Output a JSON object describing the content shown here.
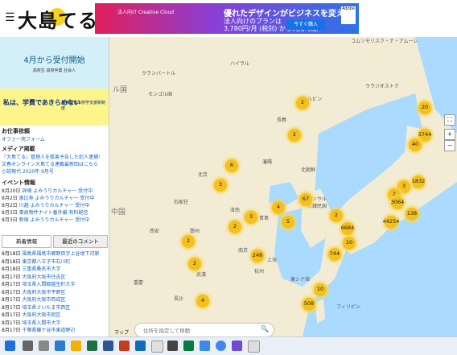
{
  "header": {
    "logo_text": "大島てる"
  },
  "ad_top": {
    "small": "法人向け Creative Cloud",
    "headline": "優れたデザインがビジネスを変える",
    "sub1": "法人向けのプランは",
    "sub2": "3,780円/月 (税別) から利用可能",
    "button": "今すぐ購入",
    "brand": "Adobe"
  },
  "ad_side": {
    "title": "4月から受付開始",
    "sub": "高校生 高校卒業 社会人",
    "slogan": "私は、学費であきらめない",
    "badge": "高等教育の修学支援新制度"
  },
  "sections": {
    "requests": {
      "title": "お仕事依頼",
      "link": "オファー用フォーム"
    },
    "media": {
      "title": "メディア掲載",
      "items": [
        "『大島てる』管理人を殺害予告した犯人逮捕!",
        "文春オンライン大島てる連載最新回はこちら",
        "小説現代 2020年 9月号"
      ]
    },
    "events": {
      "title": "イベント情報",
      "items": [
        {
          "date": "8月20日",
          "text": "詳細 よみうりカルチャー 受付中"
        },
        {
          "date": "8月2日",
          "text": "恵比寿 よみうりカルチャー 受付中"
        },
        {
          "date": "8月2日",
          "text": "川越 よみうりカルチャー 受付中"
        },
        {
          "date": "8月3日",
          "text": "事故物件ナイト番外編 有料配信"
        },
        {
          "date": "8月3日",
          "text": "新宿 よみうりカルチャー 受付中"
        }
      ]
    }
  },
  "tabs": {
    "news": "新着情報",
    "comments": "最近のコメント"
  },
  "news": [
    {
      "date": "8月18日",
      "text": "福島県福島市郷野目字上谷地下河原"
    },
    {
      "date": "8月18日",
      "text": "東京都八王子市石川町"
    },
    {
      "date": "8月18日",
      "text": "三重県桑名市大字"
    },
    {
      "date": "8月17日",
      "text": "大阪府大阪市住吉区"
    },
    {
      "date": "8月17日",
      "text": "埼玉県入間郡越生町大字"
    },
    {
      "date": "8月17日",
      "text": "大阪府大阪市平野区"
    },
    {
      "date": "8月17日",
      "text": "大阪府大阪市西成区"
    },
    {
      "date": "8月17日",
      "text": "埼玉県さいたま市西区"
    },
    {
      "date": "8月17日",
      "text": "大阪府大阪市旭区"
    },
    {
      "date": "8月17日",
      "text": "埼玉県入間市大字"
    },
    {
      "date": "8月17日",
      "text": "千葉県鎌ケ谷市東道野辺"
    }
  ],
  "map": {
    "labels": [
      "ウランバートル",
      "ハイラル",
      "ハルビン",
      "長春",
      "瀋陽",
      "北朝鮮",
      "ソウル",
      "大韓民国",
      "北京",
      "天津",
      "石家荘",
      "済南",
      "青島",
      "鄭州",
      "西安",
      "武漢",
      "南京",
      "上海",
      "杭州",
      "重慶",
      "長沙",
      "東シナ海",
      "フィリピン",
      "モンゴル国",
      "コムソモリスク・ナ・アムーレ",
      "ウラジオストク"
    ],
    "country_labels": [
      "ル国",
      "中国"
    ],
    "clusters": [
      {
        "value": "2"
      },
      {
        "value": "20"
      },
      {
        "value": "3744"
      },
      {
        "value": "40"
      },
      {
        "value": "2"
      },
      {
        "value": "6"
      },
      {
        "value": "3"
      },
      {
        "value": "1832"
      },
      {
        "value": "3"
      },
      {
        "value": "2"
      },
      {
        "value": "3064"
      },
      {
        "value": "44254"
      },
      {
        "value": "138"
      },
      {
        "value": "67"
      },
      {
        "value": "2"
      },
      {
        "value": "3"
      },
      {
        "value": "4"
      },
      {
        "value": "5"
      },
      {
        "value": "2"
      },
      {
        "value": "2"
      },
      {
        "value": "10"
      },
      {
        "value": "6684"
      },
      {
        "value": "744"
      },
      {
        "value": "248"
      },
      {
        "value": "2"
      },
      {
        "value": "4"
      },
      {
        "value": "10"
      },
      {
        "value": "508"
      }
    ],
    "search_placeholder": "住所を指定して移動",
    "map_label": "マップ"
  }
}
